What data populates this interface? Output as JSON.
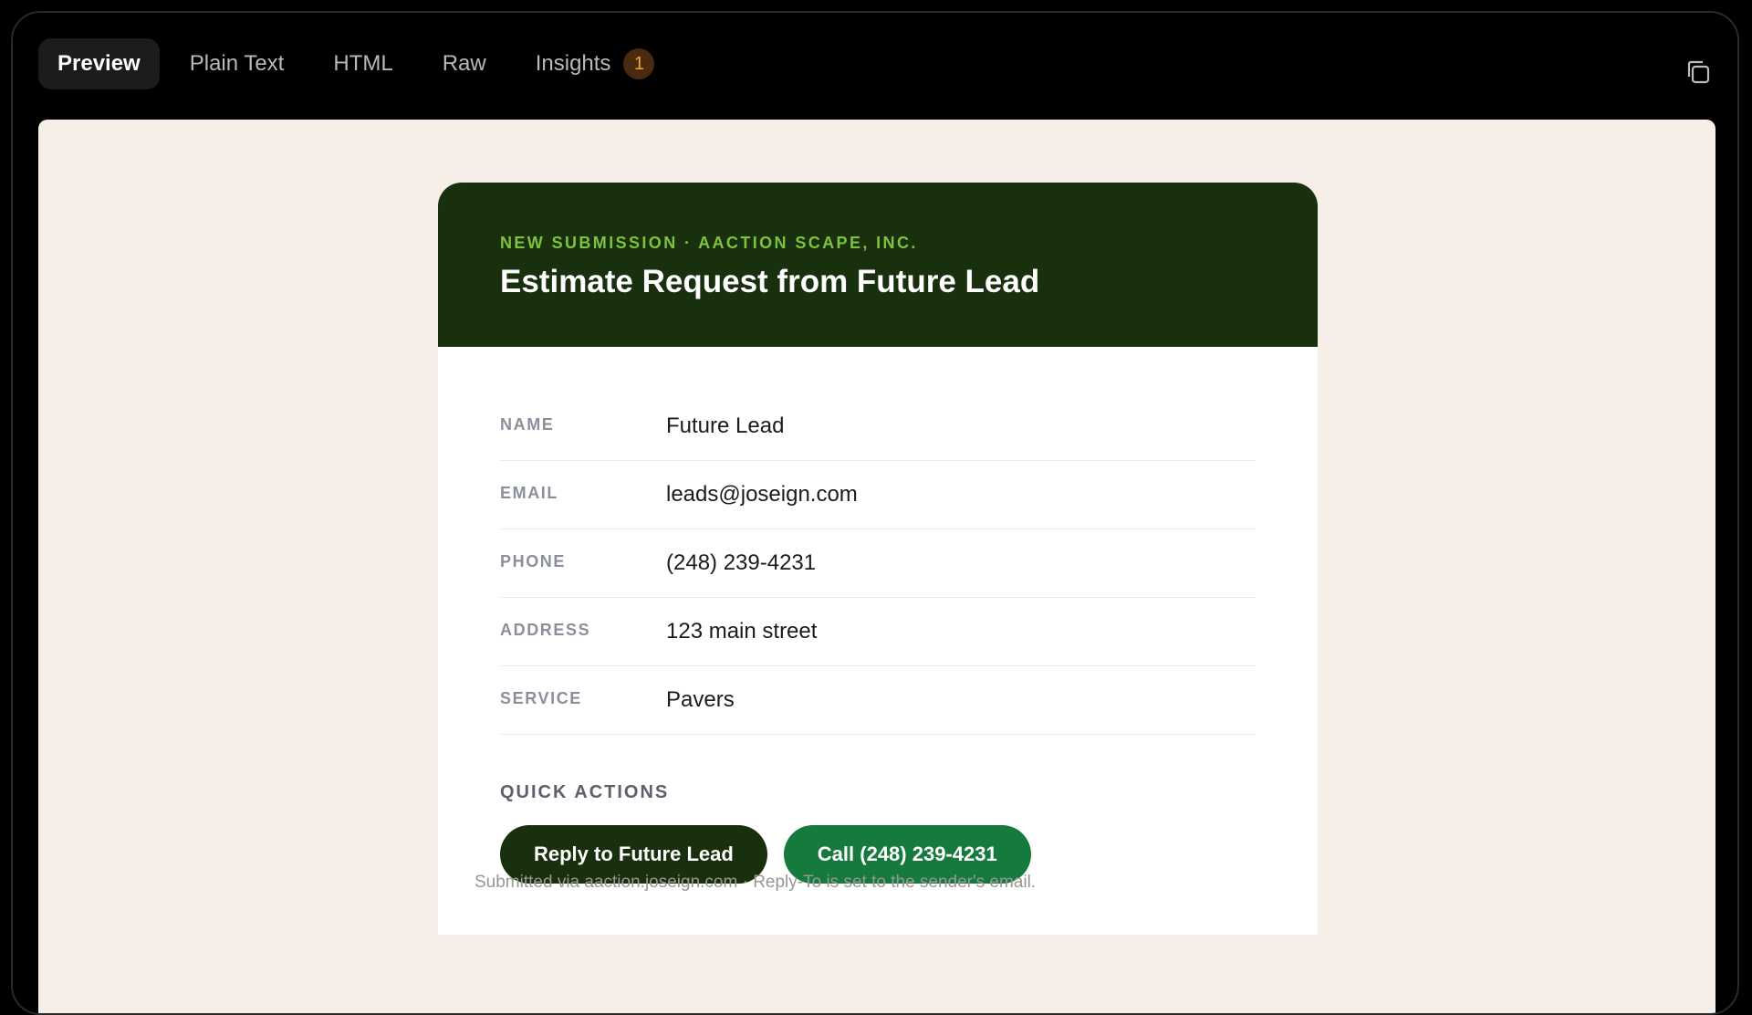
{
  "tabs": [
    {
      "label": "Preview",
      "active": true
    },
    {
      "label": "Plain Text",
      "active": false
    },
    {
      "label": "HTML",
      "active": false
    },
    {
      "label": "Raw",
      "active": false
    },
    {
      "label": "Insights",
      "active": false,
      "badge": "1"
    }
  ],
  "toolbar": {
    "copy_icon": "copy-icon"
  },
  "email": {
    "eyebrow": "NEW SUBMISSION · AACTION SCAPE, INC.",
    "title": "Estimate Request from Future Lead",
    "fields": [
      {
        "label": "NAME",
        "value": "Future Lead"
      },
      {
        "label": "EMAIL",
        "value": "leads@joseign.com"
      },
      {
        "label": "PHONE",
        "value": "(248) 239-4231"
      },
      {
        "label": "ADDRESS",
        "value": "123 main street"
      },
      {
        "label": "SERVICE",
        "value": "Pavers"
      }
    ],
    "quick_actions_heading": "QUICK ACTIONS",
    "reply_button": "Reply to Future Lead",
    "call_button": "Call (248) 239-4231",
    "footer": "Submitted via aaction.joseign.com · Reply-To is set to the sender's email."
  },
  "colors": {
    "header_green": "#18300d",
    "accent_green": "#7ec23f",
    "call_green": "#167a3e",
    "canvas_bg": "#f6efe7",
    "badge_bg": "#4a2b0f",
    "badge_text": "#f5a33b"
  }
}
